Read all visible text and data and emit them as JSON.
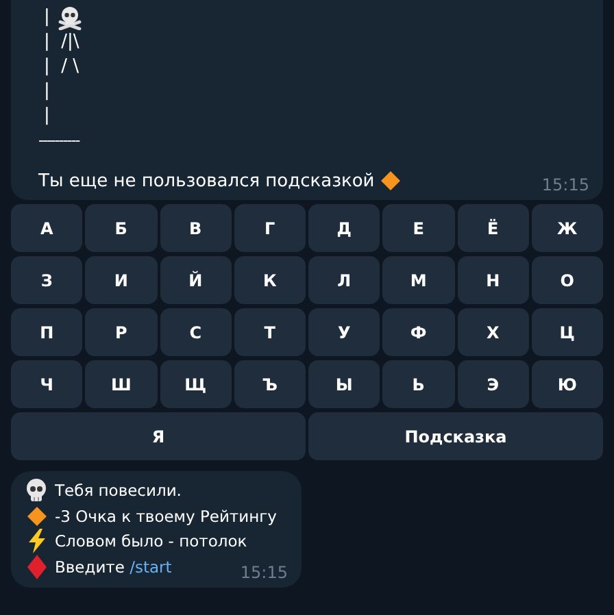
{
  "art_message": {
    "lines": [
      {
        "text": "|",
        "kind": "skull"
      },
      {
        "text": "|  /|\\",
        "kind": "text"
      },
      {
        "text": "|  / \\",
        "kind": "text"
      },
      {
        "text": "|",
        "kind": "text"
      },
      {
        "text": "|",
        "kind": "text"
      },
      {
        "text": "----------",
        "kind": "rule"
      }
    ],
    "text": "Ты еще не пользовался подсказкой",
    "icon": {
      "kind": "diamond"
    },
    "time": "15:15"
  },
  "keyboard": {
    "rows": [
      [
        "А",
        "Б",
        "В",
        "Г",
        "Д",
        "Е",
        "Ё",
        "Ж"
      ],
      [
        "З",
        "И",
        "Й",
        "К",
        "Л",
        "М",
        "Н",
        "О"
      ],
      [
        "П",
        "Р",
        "С",
        "Т",
        "У",
        "Ф",
        "Х",
        "Ц"
      ],
      [
        "Ч",
        "Ш",
        "Щ",
        "Ъ",
        "Ы",
        "Ь",
        "Э",
        "Ю"
      ]
    ],
    "wide_buttons": [
      "Я",
      "Подсказка"
    ]
  },
  "result_message": {
    "lines": [
      {
        "kind": "skull",
        "text": "Тебя повесили."
      },
      {
        "kind": "diamond",
        "text": "-3 Очка к твоему Рейтингу"
      },
      {
        "kind": "bolt",
        "text": "Словом было - потолок"
      },
      {
        "kind": "red-diamond",
        "text": "Введите",
        "link": "/start"
      }
    ],
    "time": "15:15"
  }
}
